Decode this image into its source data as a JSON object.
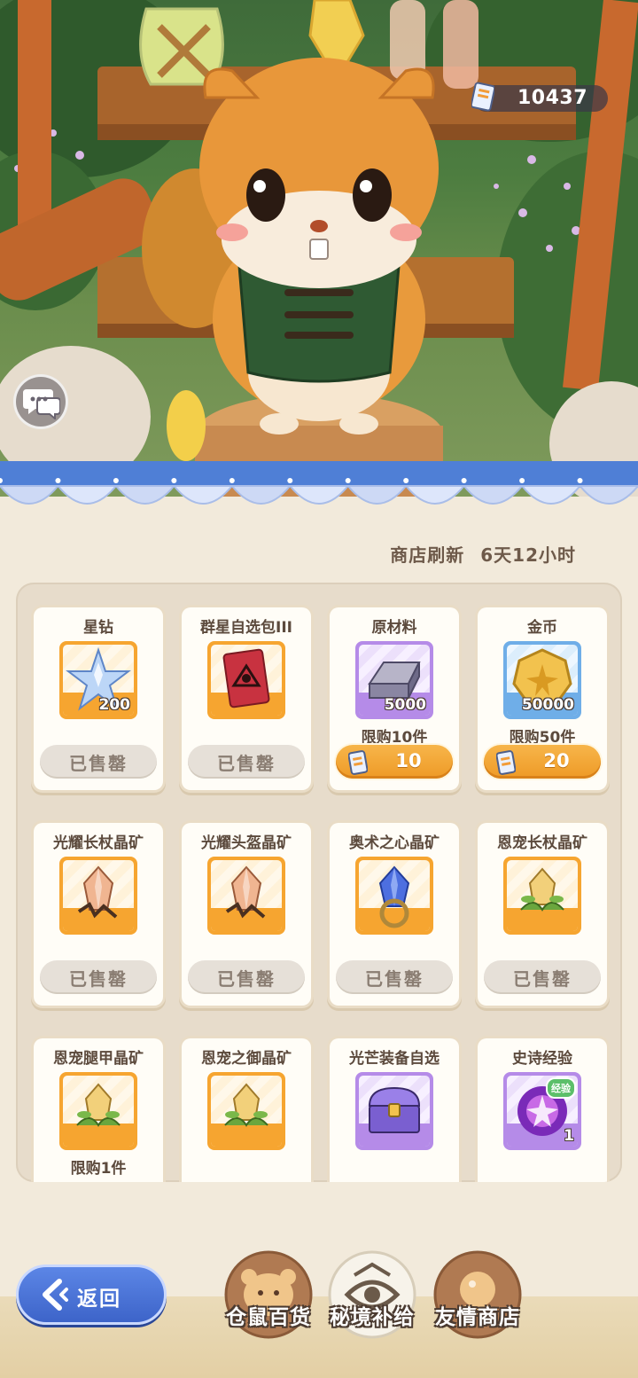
{
  "currency": {
    "amount": "10437",
    "icon": "ticket-icon"
  },
  "chat": {
    "icon": "chat-bubble-icon"
  },
  "shop": {
    "refresh_label": "商店刷新",
    "refresh_time": "6天12小时",
    "items": [
      {
        "name": "星钻",
        "icon": "star-diamond-icon",
        "qty": "200",
        "rarity": "orange",
        "state": "sold",
        "sold_label": "已售罄"
      },
      {
        "name": "群星自选包III",
        "icon": "card-pack-icon",
        "qty": "",
        "rarity": "orange",
        "state": "sold",
        "sold_label": "已售罄"
      },
      {
        "name": "原材料",
        "icon": "metal-ingot-icon",
        "qty": "5000",
        "rarity": "purple",
        "state": "buy",
        "limit": "限购10件",
        "price": "10"
      },
      {
        "name": "金币",
        "icon": "gold-coin-icon",
        "qty": "50000",
        "rarity": "blue",
        "state": "buy",
        "limit": "限购50件",
        "price": "20"
      },
      {
        "name": "光耀长杖晶矿",
        "icon": "orange-crystal-staff-icon",
        "qty": "",
        "rarity": "orange",
        "state": "sold",
        "sold_label": "已售罄"
      },
      {
        "name": "光耀头盔晶矿",
        "icon": "orange-crystal-helmet-icon",
        "qty": "",
        "rarity": "orange",
        "state": "sold",
        "sold_label": "已售罄"
      },
      {
        "name": "奥术之心晶矿",
        "icon": "blue-crystal-icon",
        "qty": "",
        "rarity": "orange",
        "state": "sold",
        "sold_label": "已售罄"
      },
      {
        "name": "恩宠长杖晶矿",
        "icon": "green-crystal-staff-icon",
        "qty": "",
        "rarity": "orange",
        "state": "sold",
        "sold_label": "已售罄"
      },
      {
        "name": "恩宠腿甲晶矿",
        "icon": "green-crystal-leg-icon",
        "qty": "",
        "rarity": "orange",
        "state": "limit",
        "limit": "限购1件"
      },
      {
        "name": "恩宠之御晶矿",
        "icon": "green-crystal-shield-icon",
        "qty": "",
        "rarity": "orange",
        "state": "none"
      },
      {
        "name": "光芒装备自选",
        "icon": "treasure-chest-icon",
        "qty": "",
        "rarity": "purple",
        "state": "none"
      },
      {
        "name": "史诗经验",
        "icon": "epic-exp-orb-icon",
        "qty": "1",
        "rarity": "purple",
        "state": "none",
        "badge": "经验"
      }
    ]
  },
  "nav": {
    "back_label": "返回",
    "tabs": [
      {
        "label": "仓鼠百货",
        "icon": "hamster-emblem-icon"
      },
      {
        "label": "秘境补给",
        "icon": "eye-emblem-icon",
        "active": true
      },
      {
        "label": "友情商店",
        "icon": "crystal-ball-emblem-icon"
      }
    ]
  }
}
